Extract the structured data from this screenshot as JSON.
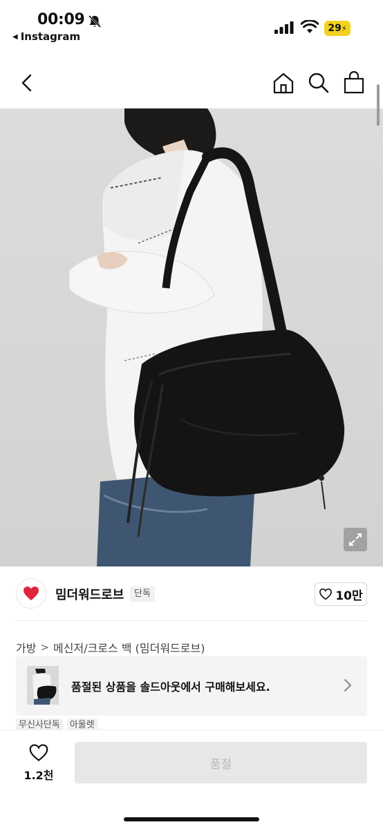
{
  "status_bar": {
    "time": "00:09",
    "back_app": "Instagram",
    "battery": "29"
  },
  "nav": {
    "icons": [
      "back-chevron-icon",
      "home-icon",
      "search-icon",
      "shopping-bag-icon"
    ]
  },
  "hero": {
    "description_icon": "expand-icon"
  },
  "brand": {
    "name": "밈더워드로브",
    "badge": "단독",
    "like_count": "10만"
  },
  "breadcrumb": {
    "category": "가방",
    "separator": ">",
    "subcategory": "메신저/크로스 백 (밈더워드로브)"
  },
  "banner": {
    "text": "품절된 상품을 솔드아웃에서 구매해보세요."
  },
  "tags": [
    "무신사단독",
    "아울렛"
  ],
  "bottom_bar": {
    "wish_count": "1.2천",
    "buy_label": "품절"
  },
  "colors": {
    "accent_yellow": "#f2d21f",
    "brand_red": "#e0263c",
    "disabled_gray": "#e7e7e7"
  }
}
